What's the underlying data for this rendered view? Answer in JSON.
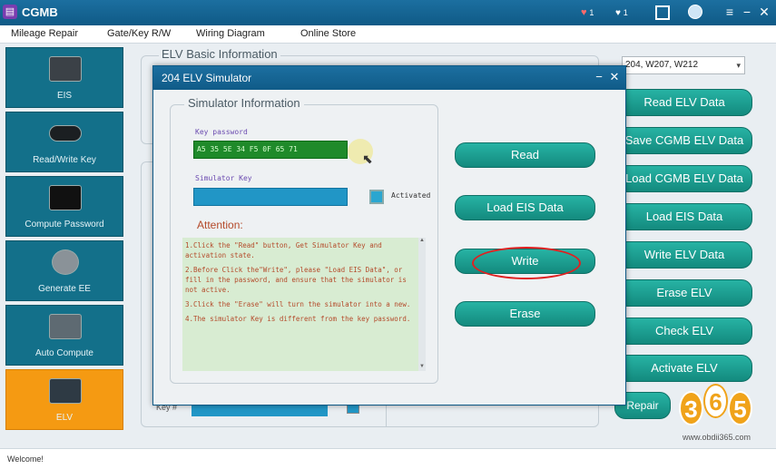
{
  "app": {
    "logo_glyph": "▤",
    "title": "CGMB",
    "badges": [
      "1",
      "1"
    ],
    "win_min": "−",
    "win_close": "✕"
  },
  "menu": [
    "Mileage Repair",
    "Gate/Key R/W",
    "Wiring Diagram",
    "Online Store"
  ],
  "sidebar": [
    {
      "label": "EIS",
      "icon": "eis-icon"
    },
    {
      "label": "Read/Write Key",
      "icon": "key-icon"
    },
    {
      "label": "Compute Password",
      "icon": "device-icon"
    },
    {
      "label": "Generate EE",
      "icon": "chip-icon"
    },
    {
      "label": "Auto Compute",
      "icon": "computer-icon"
    },
    {
      "label": "ELV",
      "icon": "elv-icon",
      "active": true
    }
  ],
  "main": {
    "basic_info_title": "ELV Basic Information",
    "model_select": "204, W207, W212",
    "right_buttons": [
      "Read ELV Data",
      "Save CGMB ELV Data",
      "Load CGMB ELV Data",
      "Load EIS Data",
      "Write ELV Data",
      "Erase ELV",
      "Check ELV",
      "Activate ELV"
    ],
    "repair_label": "Repair",
    "key_label": "Key #"
  },
  "modal": {
    "title": "204 ELV Simulator",
    "group_title": "Simulator Information",
    "key_password_label": "Key password",
    "key_password_value": "A5 35 5E 34 F5 0F 65 71",
    "simulator_key_label": "Simulator Key",
    "simulator_key_value": "",
    "activated_label": "Activated",
    "attention_title": "Attention:",
    "notes": [
      "1.Click the \"Read\" button, Get Simulator Key and activation state.",
      "2.Before Click the\"Write\", please \"Load EIS Data\", or fill in the password, and ensure that the simulator is not active.",
      "3.Click the \"Erase\" will turn the simulator into a new.",
      "4.The simulator Key is different from the key password."
    ],
    "buttons": [
      "Read",
      "Load EIS Data",
      "Write",
      "Erase"
    ]
  },
  "status": {
    "text": "Welcome!"
  },
  "watermark": {
    "digits": [
      "3",
      "6",
      "5"
    ],
    "site": "www.obdii365.com"
  },
  "colors": {
    "accent": "#1c6fa0",
    "button": "#1a9e91",
    "active_tab": "#f59a12",
    "highlight": "#e02020"
  }
}
